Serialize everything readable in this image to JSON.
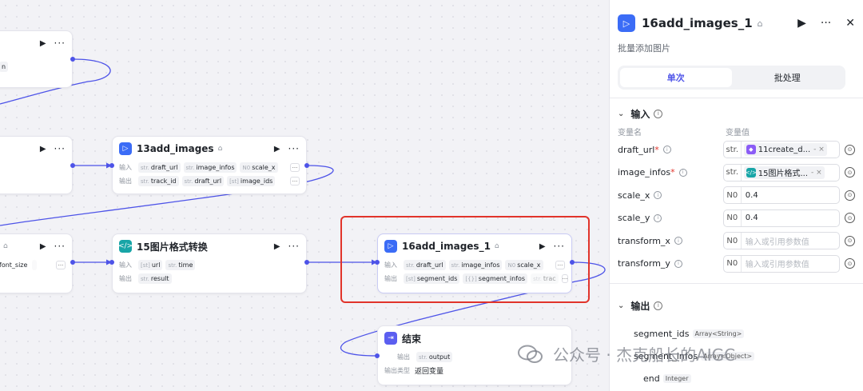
{
  "nodes": {
    "top_left": {
      "tail": "n"
    },
    "mid_left": {},
    "left_third": {
      "tail": "font_size"
    },
    "add13": {
      "title": "13add_images",
      "in_label": "输入",
      "out_label": "输出",
      "inputs": [
        {
          "type": "str.",
          "name": "draft_url"
        },
        {
          "type": "str.",
          "name": "image_infos"
        },
        {
          "type": "N0",
          "name": "scale_x"
        }
      ],
      "outputs": [
        {
          "type": "str.",
          "name": "track_id"
        },
        {
          "type": "str.",
          "name": "draft_url"
        },
        {
          "type": "[st]",
          "name": "image_ids"
        }
      ]
    },
    "convert15": {
      "title": "15图片格式转换",
      "in_label": "输入",
      "out_label": "输出",
      "inputs": [
        {
          "type": "[st]",
          "name": "url"
        },
        {
          "type": "str.",
          "name": "time"
        }
      ],
      "outputs": [
        {
          "type": "str.",
          "name": "result"
        }
      ]
    },
    "add16": {
      "title": "16add_images_1",
      "in_label": "输入",
      "out_label": "输出",
      "inputs": [
        {
          "type": "str.",
          "name": "draft_url"
        },
        {
          "type": "str.",
          "name": "image_infos"
        },
        {
          "type": "N0",
          "name": "scale_x"
        }
      ],
      "outputs": [
        {
          "type": "[st]",
          "name": "segment_ids"
        },
        {
          "type": "[{}]",
          "name": "segment_infos"
        },
        {
          "type": "str.",
          "name": "trac"
        }
      ]
    },
    "end": {
      "title": "结束",
      "out_label": "输出",
      "output": {
        "type": "str.",
        "name": "output"
      },
      "type_label": "输出类型",
      "type_value": "返回变量"
    }
  },
  "panel": {
    "title": "16add_images_1",
    "description": "批量添加图片",
    "tabs": [
      {
        "label": "单次",
        "active": true
      },
      {
        "label": "批处理",
        "active": false
      }
    ],
    "input_section": "输入",
    "col_name": "变量名",
    "col_value": "变量值",
    "params": [
      {
        "name": "draft_url",
        "required": true,
        "type": "str.",
        "ref": "11create_d...",
        "ref_color": "#8b5cf6"
      },
      {
        "name": "image_infos",
        "required": true,
        "type": "str.",
        "ref": "15图片格式...",
        "ref_color": "#18a5a7"
      },
      {
        "name": "scale_x",
        "required": false,
        "type": "N0",
        "value": "0.4"
      },
      {
        "name": "scale_y",
        "required": false,
        "type": "N0",
        "value": "0.4"
      },
      {
        "name": "transform_x",
        "required": false,
        "type": "N0",
        "placeholder": "输入或引用参数值"
      },
      {
        "name": "transform_y",
        "required": false,
        "type": "N0",
        "placeholder": "输入或引用参数值"
      }
    ],
    "output_section": "输出",
    "outputs": [
      {
        "name": "segment_ids",
        "type": "Array<String>"
      },
      {
        "name": "segment_infos",
        "type": "Array<Object>"
      },
      {
        "name": "end",
        "type": "Integer"
      }
    ]
  },
  "watermark": "公众号 · 杰克船长的AIGC",
  "colors": {
    "accent": "#4d53e8",
    "highlight": "#e1342b",
    "node_blue": "#3b6cf6",
    "node_teal": "#18a5a7"
  }
}
